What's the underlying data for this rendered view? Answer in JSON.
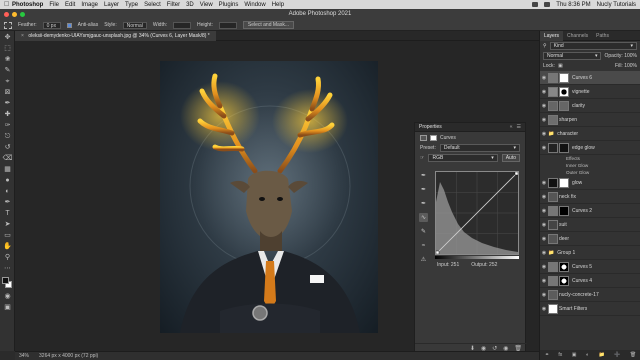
{
  "menubar": {
    "app_name": "Photoshop",
    "items": [
      "File",
      "Edit",
      "Image",
      "Layer",
      "Type",
      "Select",
      "Filter",
      "3D",
      "View",
      "Plugins",
      "Window",
      "Help"
    ],
    "clock": "Thu 8:36 PM",
    "user": "Nucly Tutorials"
  },
  "window": {
    "title": "Adobe Photoshop 2021"
  },
  "options": {
    "feather_label": "Feather:",
    "feather_value": "0 px",
    "antialias_label": "Anti-alias",
    "style_label": "Style:",
    "style_value": "Normal",
    "width_label": "Width:",
    "height_label": "Height:",
    "select_mask_label": "Select and Mask..."
  },
  "document": {
    "tab_title": "oleksii-demydenko-UIAYsmjgauc-unsplash.jpg @ 34% (Curves 6, Layer Mask/8) *",
    "zoom": "34%",
    "dimensions": "3264 px x 4000 px (72 ppi)"
  },
  "properties": {
    "title": "Properties",
    "adjustment": "Curves",
    "preset_label": "Preset:",
    "preset_value": "Default",
    "channel": "RGB",
    "auto_label": "Auto",
    "input_label": "Input: 251",
    "output_label": "Output: 252"
  },
  "layers": {
    "tabs": [
      "Layers",
      "Channels",
      "Paths"
    ],
    "filter_kind": "Kind",
    "blend_mode": "Normal",
    "opacity_label": "Opacity: 100%",
    "lock_label": "Lock:",
    "fill_label": "Fill: 100%",
    "rows": [
      {
        "name": "Curves 6",
        "thumb": "#777"
      },
      {
        "name": "vignette",
        "thumb": "#888"
      },
      {
        "name": "clarity",
        "thumb": "#666"
      },
      {
        "name": "sharpen",
        "thumb": "#6e6e6e"
      },
      {
        "name": "character",
        "thumb": "#555"
      },
      {
        "name": "edge glow",
        "thumb": "#222"
      },
      {
        "name": "Effects",
        "thumb": ""
      },
      {
        "name": "Inner Glow",
        "thumb": ""
      },
      {
        "name": "Outer Glow",
        "thumb": ""
      },
      {
        "name": "glow",
        "thumb": "#111"
      },
      {
        "name": "neck fix",
        "thumb": "#555"
      },
      {
        "name": "Curves 2",
        "thumb": "#777"
      },
      {
        "name": "suit",
        "thumb": "#444"
      },
      {
        "name": "deer",
        "thumb": "#555"
      },
      {
        "name": "Group 1",
        "thumb": "#555"
      },
      {
        "name": "Curves 5",
        "thumb": "#777"
      },
      {
        "name": "Curves 4",
        "thumb": "#777"
      },
      {
        "name": "nucly-concrete-17",
        "thumb": "#5c5c5c"
      },
      {
        "name": "Smart Filters",
        "thumb": "#fff"
      }
    ]
  }
}
